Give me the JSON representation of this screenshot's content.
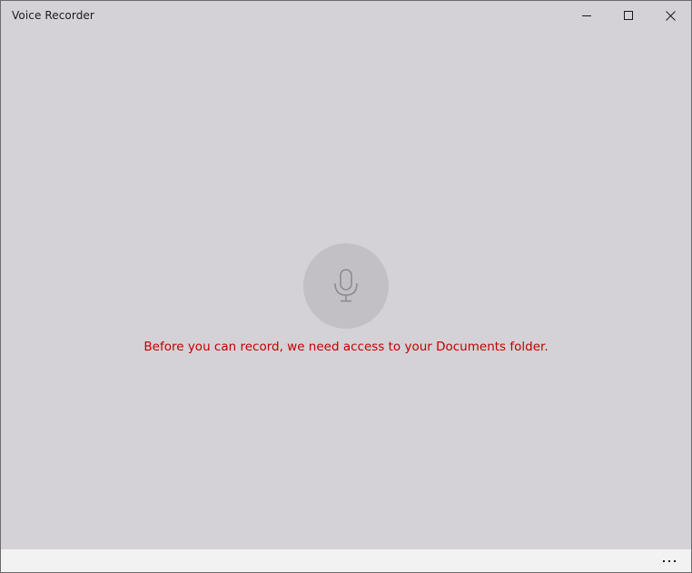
{
  "window": {
    "title": "Voice Recorder",
    "controls": {
      "minimize": "minimize-icon",
      "maximize": "maximize-icon",
      "close": "close-icon"
    }
  },
  "main": {
    "record_icon": "microphone-icon",
    "message": "Before you can record, we need access to your Documents folder."
  },
  "appbar": {
    "more_icon": "more-ellipsis-icon"
  },
  "colors": {
    "background": "#d4d2d6",
    "record_button": "#c2c0c4",
    "message_text": "#c00000",
    "appbar": "#f2f2f2"
  }
}
